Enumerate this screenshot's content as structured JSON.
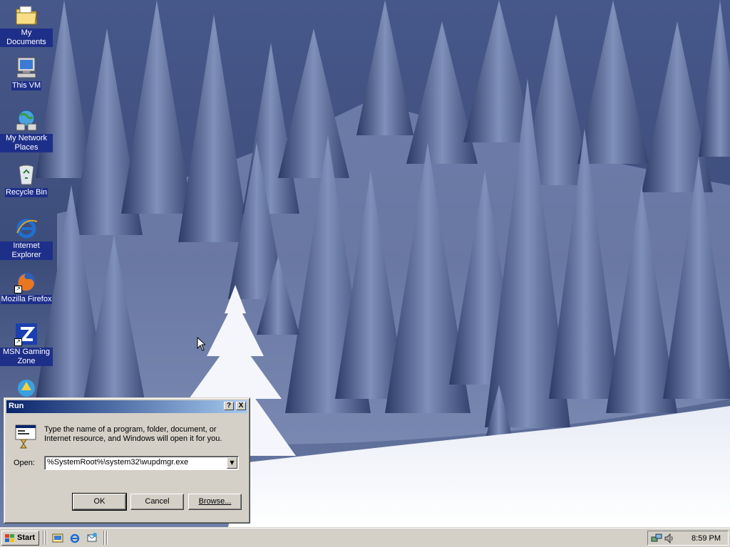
{
  "desktop": {
    "icons": [
      {
        "label": "My Documents",
        "icon": "folder-documents-icon"
      },
      {
        "label": "This VM",
        "icon": "computer-icon"
      },
      {
        "label": "My Network Places",
        "icon": "network-places-icon"
      },
      {
        "label": "Recycle Bin",
        "icon": "recycle-bin-icon"
      },
      {
        "label": "Internet Explorer",
        "icon": "internet-explorer-icon"
      },
      {
        "label": "Mozilla Firefox",
        "icon": "firefox-icon"
      },
      {
        "label": "MSN Gaming Zone",
        "icon": "msn-gaming-zone-icon"
      },
      {
        "label": "",
        "icon": "shortcut-program-icon"
      }
    ]
  },
  "run_dialog": {
    "title": "Run",
    "help_label": "?",
    "close_label": "X",
    "prompt": "Type the name of a program, folder, document, or Internet resource, and Windows will open it for you.",
    "open_label": "Open:",
    "open_value": "%SystemRoot%\\system32\\wupdmgr.exe",
    "ok_label": "OK",
    "cancel_label": "Cancel",
    "browse_label": "Browse..."
  },
  "taskbar": {
    "start_label": "Start",
    "quick_launch": [
      "show-desktop-icon",
      "internet-explorer-icon",
      "outlook-express-icon"
    ],
    "tray_icons": [
      "network-icon",
      "volume-icon"
    ],
    "clock": "8:59 PM"
  },
  "colors": {
    "titlebar_start": "#0a246a",
    "titlebar_end": "#a6caf0",
    "chrome": "#d4d0c8",
    "icon_label_bg": "#1e2f8a"
  }
}
